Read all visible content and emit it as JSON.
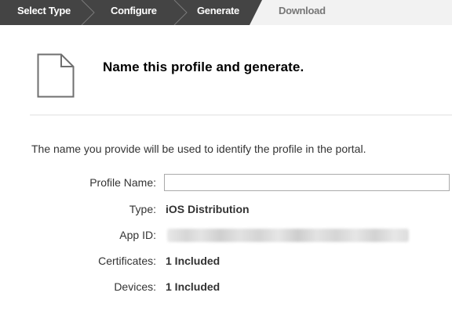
{
  "steps": [
    {
      "label": "Select Type",
      "state": "complete"
    },
    {
      "label": "Configure",
      "state": "complete"
    },
    {
      "label": "Generate",
      "state": "current"
    },
    {
      "label": "Download",
      "state": "upcoming"
    }
  ],
  "header": {
    "icon": "document-icon",
    "title": "Name this profile and generate."
  },
  "intro": "The name you provide will be used to identify the profile in the portal.",
  "form": {
    "profile_name": {
      "label": "Profile Name:",
      "value": "",
      "placeholder": ""
    },
    "type": {
      "label": "Type:",
      "value": "iOS Distribution"
    },
    "app_id": {
      "label": "App ID:",
      "value_state": "obscured"
    },
    "certificates": {
      "label": "Certificates:",
      "value": "1 Included"
    },
    "devices": {
      "label": "Devices:",
      "value": "1 Included"
    }
  },
  "colors": {
    "step_active": "#444444",
    "step_inactive": "#f2f2f2",
    "step_divider": "#ffffff",
    "title": "#000000",
    "text": "#333333"
  }
}
